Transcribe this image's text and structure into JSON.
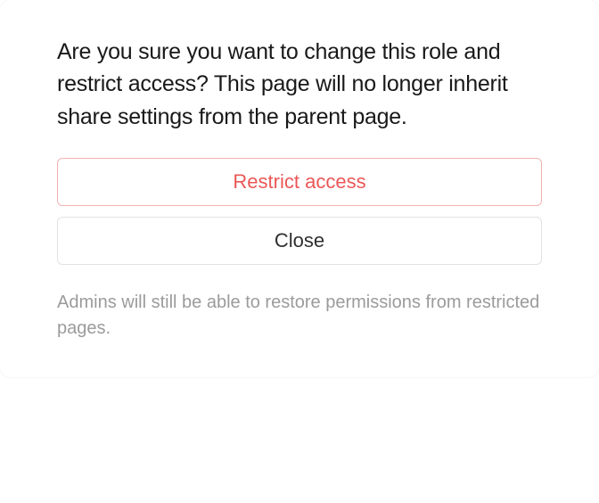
{
  "dialog": {
    "message": "Are you sure you want to change this role and restrict access? This page will no longer inherit share settings from the parent page.",
    "restrict_label": "Restrict access",
    "close_label": "Close",
    "footer_note": "Admins will still be able to restore permissions from restricted pages."
  }
}
